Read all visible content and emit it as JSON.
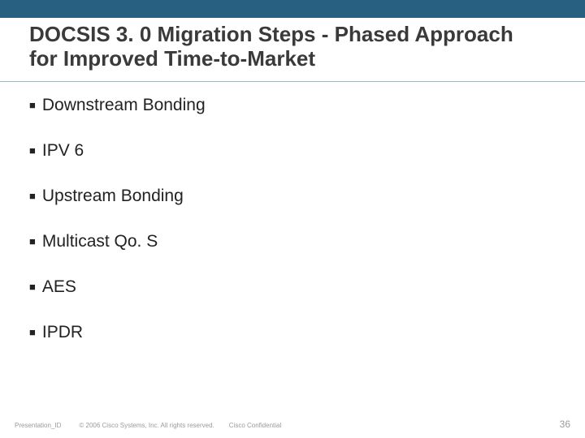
{
  "header": {
    "title": "DOCSIS 3. 0 Migration Steps - Phased Approach for Improved Time-to-Market"
  },
  "bullets": [
    "Downstream Bonding",
    "IPV 6",
    "Upstream Bonding",
    "Multicast Qo. S",
    "AES",
    "IPDR"
  ],
  "footer": {
    "presentation_id": "Presentation_ID",
    "copyright": "© 2006 Cisco Systems, Inc. All rights reserved.",
    "confidential": "Cisco Confidential",
    "page": "36"
  }
}
